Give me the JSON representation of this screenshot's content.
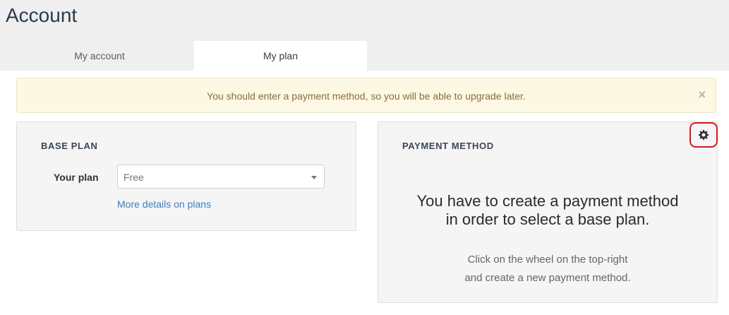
{
  "page": {
    "title": "Account"
  },
  "tabs": [
    {
      "label": "My account",
      "active": false
    },
    {
      "label": "My plan",
      "active": true
    }
  ],
  "alert": {
    "message": "You should enter a payment method, so you will be able to upgrade later.",
    "close_symbol": "×"
  },
  "base_plan": {
    "title": "BASE PLAN",
    "plan_label": "Your plan",
    "selected_plan": "Free",
    "details_link": "More details on plans"
  },
  "payment_method": {
    "title": "PAYMENT METHOD",
    "settings_icon": "gear-icon",
    "message_line1": "You have to create a payment method",
    "message_line2": "in order to select a base plan.",
    "hint_line1": "Click on the wheel on the top-right",
    "hint_line2": "and create a new payment method."
  },
  "colors": {
    "alert_background": "#fcf8e3",
    "alert_text": "#8a6d3b",
    "link": "#3b7dc4",
    "highlight_border": "#e3121b"
  }
}
